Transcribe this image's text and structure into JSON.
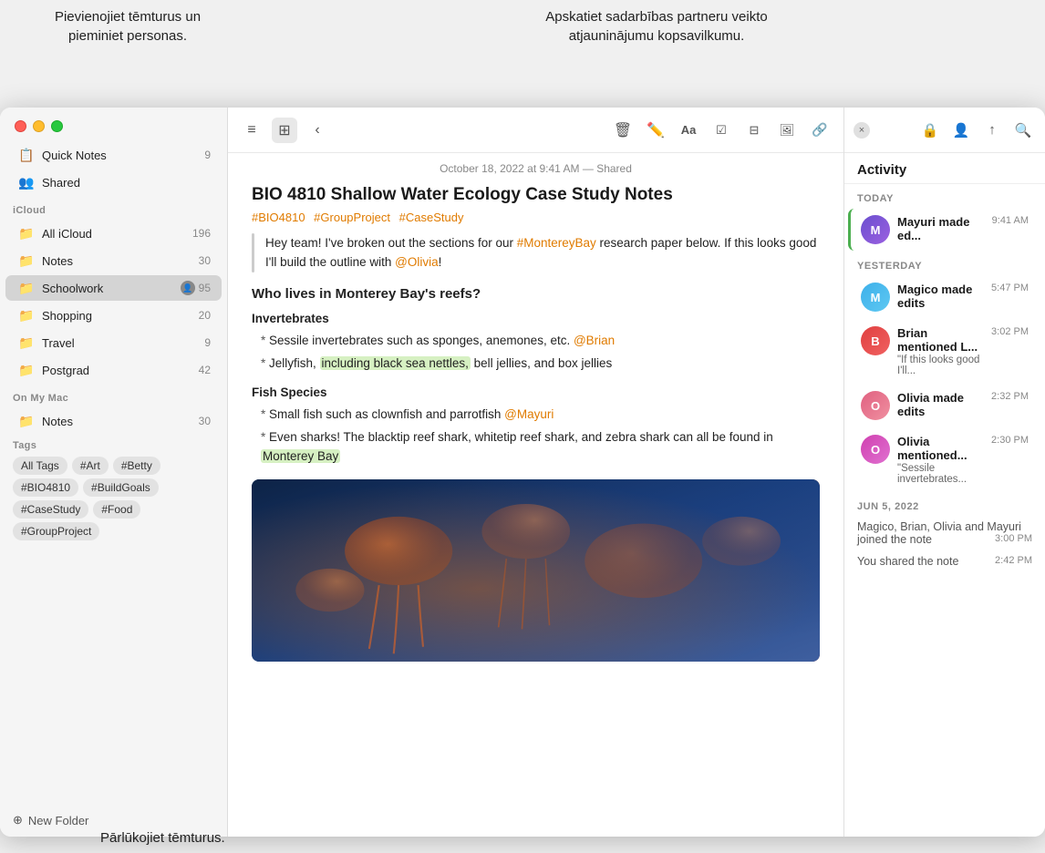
{
  "annotations": {
    "top_left": "Pievienojiet\ntēmturus un\npieminiet personas.",
    "top_right": "Apskatiet sadarbības\npartneru veikto\natjauninājumu kopsavilkumu.",
    "bottom": "Pārlūkojiet tēmturus."
  },
  "window_controls": {
    "red": "close",
    "yellow": "minimize",
    "green": "maximize"
  },
  "sidebar": {
    "quick_notes": {
      "label": "Quick Notes",
      "count": "9",
      "icon": "📋"
    },
    "shared": {
      "label": "Shared",
      "icon": "👤"
    },
    "icloud_section": "iCloud",
    "icloud_items": [
      {
        "label": "All iCloud",
        "count": "196",
        "icon": "☁️"
      },
      {
        "label": "Notes",
        "count": "30",
        "icon": "📁"
      },
      {
        "label": "Schoolwork",
        "count": "95",
        "icon": "📁",
        "active": true,
        "shared": true
      },
      {
        "label": "Shopping",
        "count": "20",
        "icon": "📁"
      },
      {
        "label": "Travel",
        "count": "9",
        "icon": "📁"
      },
      {
        "label": "Postgrad",
        "count": "42",
        "icon": "📁"
      }
    ],
    "on_my_mac_section": "On My Mac",
    "on_my_mac_items": [
      {
        "label": "Notes",
        "count": "30",
        "icon": "📁"
      }
    ],
    "tags_section": "Tags",
    "tags": [
      "All Tags",
      "#Art",
      "#Betty",
      "#BIO4810",
      "#BuildGoals",
      "#CaseStudy",
      "#Food",
      "#GroupProject"
    ],
    "new_folder_label": "New Folder"
  },
  "toolbar": {
    "list_icon": "≡",
    "grid_icon": "⊞",
    "back_icon": "‹",
    "delete_icon": "🗑",
    "compose_icon": "✏",
    "format_icon": "Aa",
    "checklist_icon": "☑",
    "table_icon": "⊞",
    "media_icon": "🖼",
    "link_icon": "🔗",
    "lock_icon": "🔒",
    "collab_icon": "👤",
    "share_icon": "↑",
    "search_icon": "🔍"
  },
  "note": {
    "meta": "October 18, 2022 at 9:41 AM — Shared",
    "title": "BIO 4810 Shallow Water Ecology Case Study Notes",
    "tags": [
      "#BIO4810",
      "#GroupProject",
      "#CaseStudy"
    ],
    "body_intro": "Hey team! I've broken out the sections for our ",
    "body_link": "#MontereyBay",
    "body_mid": " research paper below. If this looks good I'll build the outline with ",
    "body_mention": "@Olivia",
    "section1": "Who lives in Monterey Bay's reefs?",
    "sub1_label": "Invertebrates",
    "sub1_items": [
      {
        "text_start": "Sessile invertebrates such as sponges, anemones, etc. ",
        "mention": "@Brian",
        "mention_rest": ""
      },
      {
        "text_start": "Jellyfish, ",
        "highlight": "including black sea nettles,",
        "text_end": " bell jellies, and box jellies"
      }
    ],
    "sub2_label": "Fish Species",
    "sub2_items": [
      {
        "text_start": "Small fish such as clownfish and parrotfish ",
        "mention": "@Mayuri",
        "mention_rest": ""
      },
      {
        "text_start": "Even sharks! The blacktip reef shark, whitetip reef shark, and zebra shark can all be found in ",
        "highlight": "Monterey Bay",
        "text_end": ""
      }
    ]
  },
  "activity": {
    "title": "Activity",
    "close_label": "×",
    "today_label": "TODAY",
    "yesterday_label": "YESTERDAY",
    "jun5_label": "JUN 5, 2022",
    "items_today": [
      {
        "user": "Mayuri",
        "action": "Mayuri made ed...",
        "time": "9:41 AM",
        "avatar": "mayuri",
        "highlighted": true
      }
    ],
    "items_yesterday": [
      {
        "user": "Magico",
        "action": "Magico made edits",
        "time": "5:47 PM",
        "avatar": "magico"
      },
      {
        "user": "Brian",
        "action": "Brian mentioned L...",
        "time": "3:02 PM",
        "avatar": "brian",
        "quote": "\"If this looks good I'll..."
      },
      {
        "user": "Olivia",
        "action": "Olivia made edits",
        "time": "2:32 PM",
        "avatar": "olivia"
      },
      {
        "user": "Olivia",
        "action": "Olivia mentioned...",
        "time": "2:30 PM",
        "avatar": "olivia2",
        "quote": "\"Sessile invertebrates..."
      }
    ],
    "items_jun5": [
      {
        "text": "Magico, Brian, Olivia and Mayuri joined the note",
        "time": "3:00 PM"
      },
      {
        "text": "You shared the note",
        "time": "2:42 PM"
      }
    ]
  }
}
